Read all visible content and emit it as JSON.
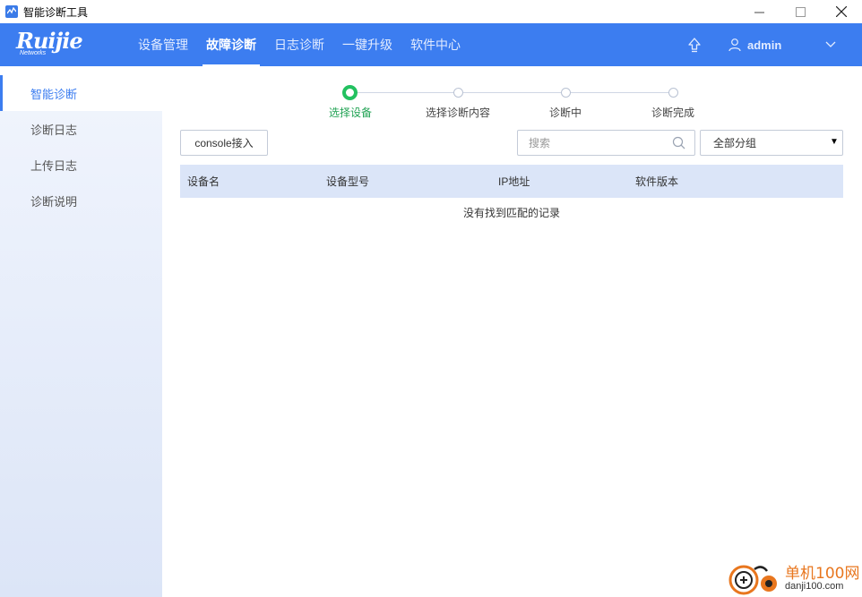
{
  "window": {
    "title": "智能诊断工具",
    "controls": {
      "minimize": "—",
      "maximize": "☐",
      "close": "✕"
    }
  },
  "header": {
    "logo_text": "Ruijie",
    "logo_sub": "Networks",
    "brand_color": "#3c7df0",
    "nav": [
      {
        "label": "设备管理",
        "active": false
      },
      {
        "label": "故障诊断",
        "active": true
      },
      {
        "label": "日志诊断",
        "active": false
      },
      {
        "label": "一键升级",
        "active": false
      },
      {
        "label": "软件中心",
        "active": false
      }
    ],
    "user": "admin"
  },
  "sidebar": {
    "items": [
      {
        "label": "智能诊断",
        "active": true
      },
      {
        "label": "诊断日志",
        "active": false
      },
      {
        "label": "上传日志",
        "active": false
      },
      {
        "label": "诊断说明",
        "active": false
      }
    ]
  },
  "steps": [
    {
      "label": "选择设备",
      "active": true
    },
    {
      "label": "选择诊断内容",
      "active": false
    },
    {
      "label": "诊断中",
      "active": false
    },
    {
      "label": "诊断完成",
      "active": false
    }
  ],
  "toolbar": {
    "console_label": "console接入",
    "search_placeholder": "搜索",
    "group_selected": "全部分组"
  },
  "table": {
    "columns": [
      "设备名",
      "设备型号",
      "IP地址",
      "软件版本"
    ],
    "rows": [],
    "empty_message": "没有找到匹配的记录"
  },
  "watermark": {
    "title": "单机100网",
    "url": "danji100.com"
  },
  "colors": {
    "accent": "#3c7df0",
    "step_active": "#23c160",
    "table_header": "#dbe5f8",
    "watermark": "#e8761e"
  }
}
